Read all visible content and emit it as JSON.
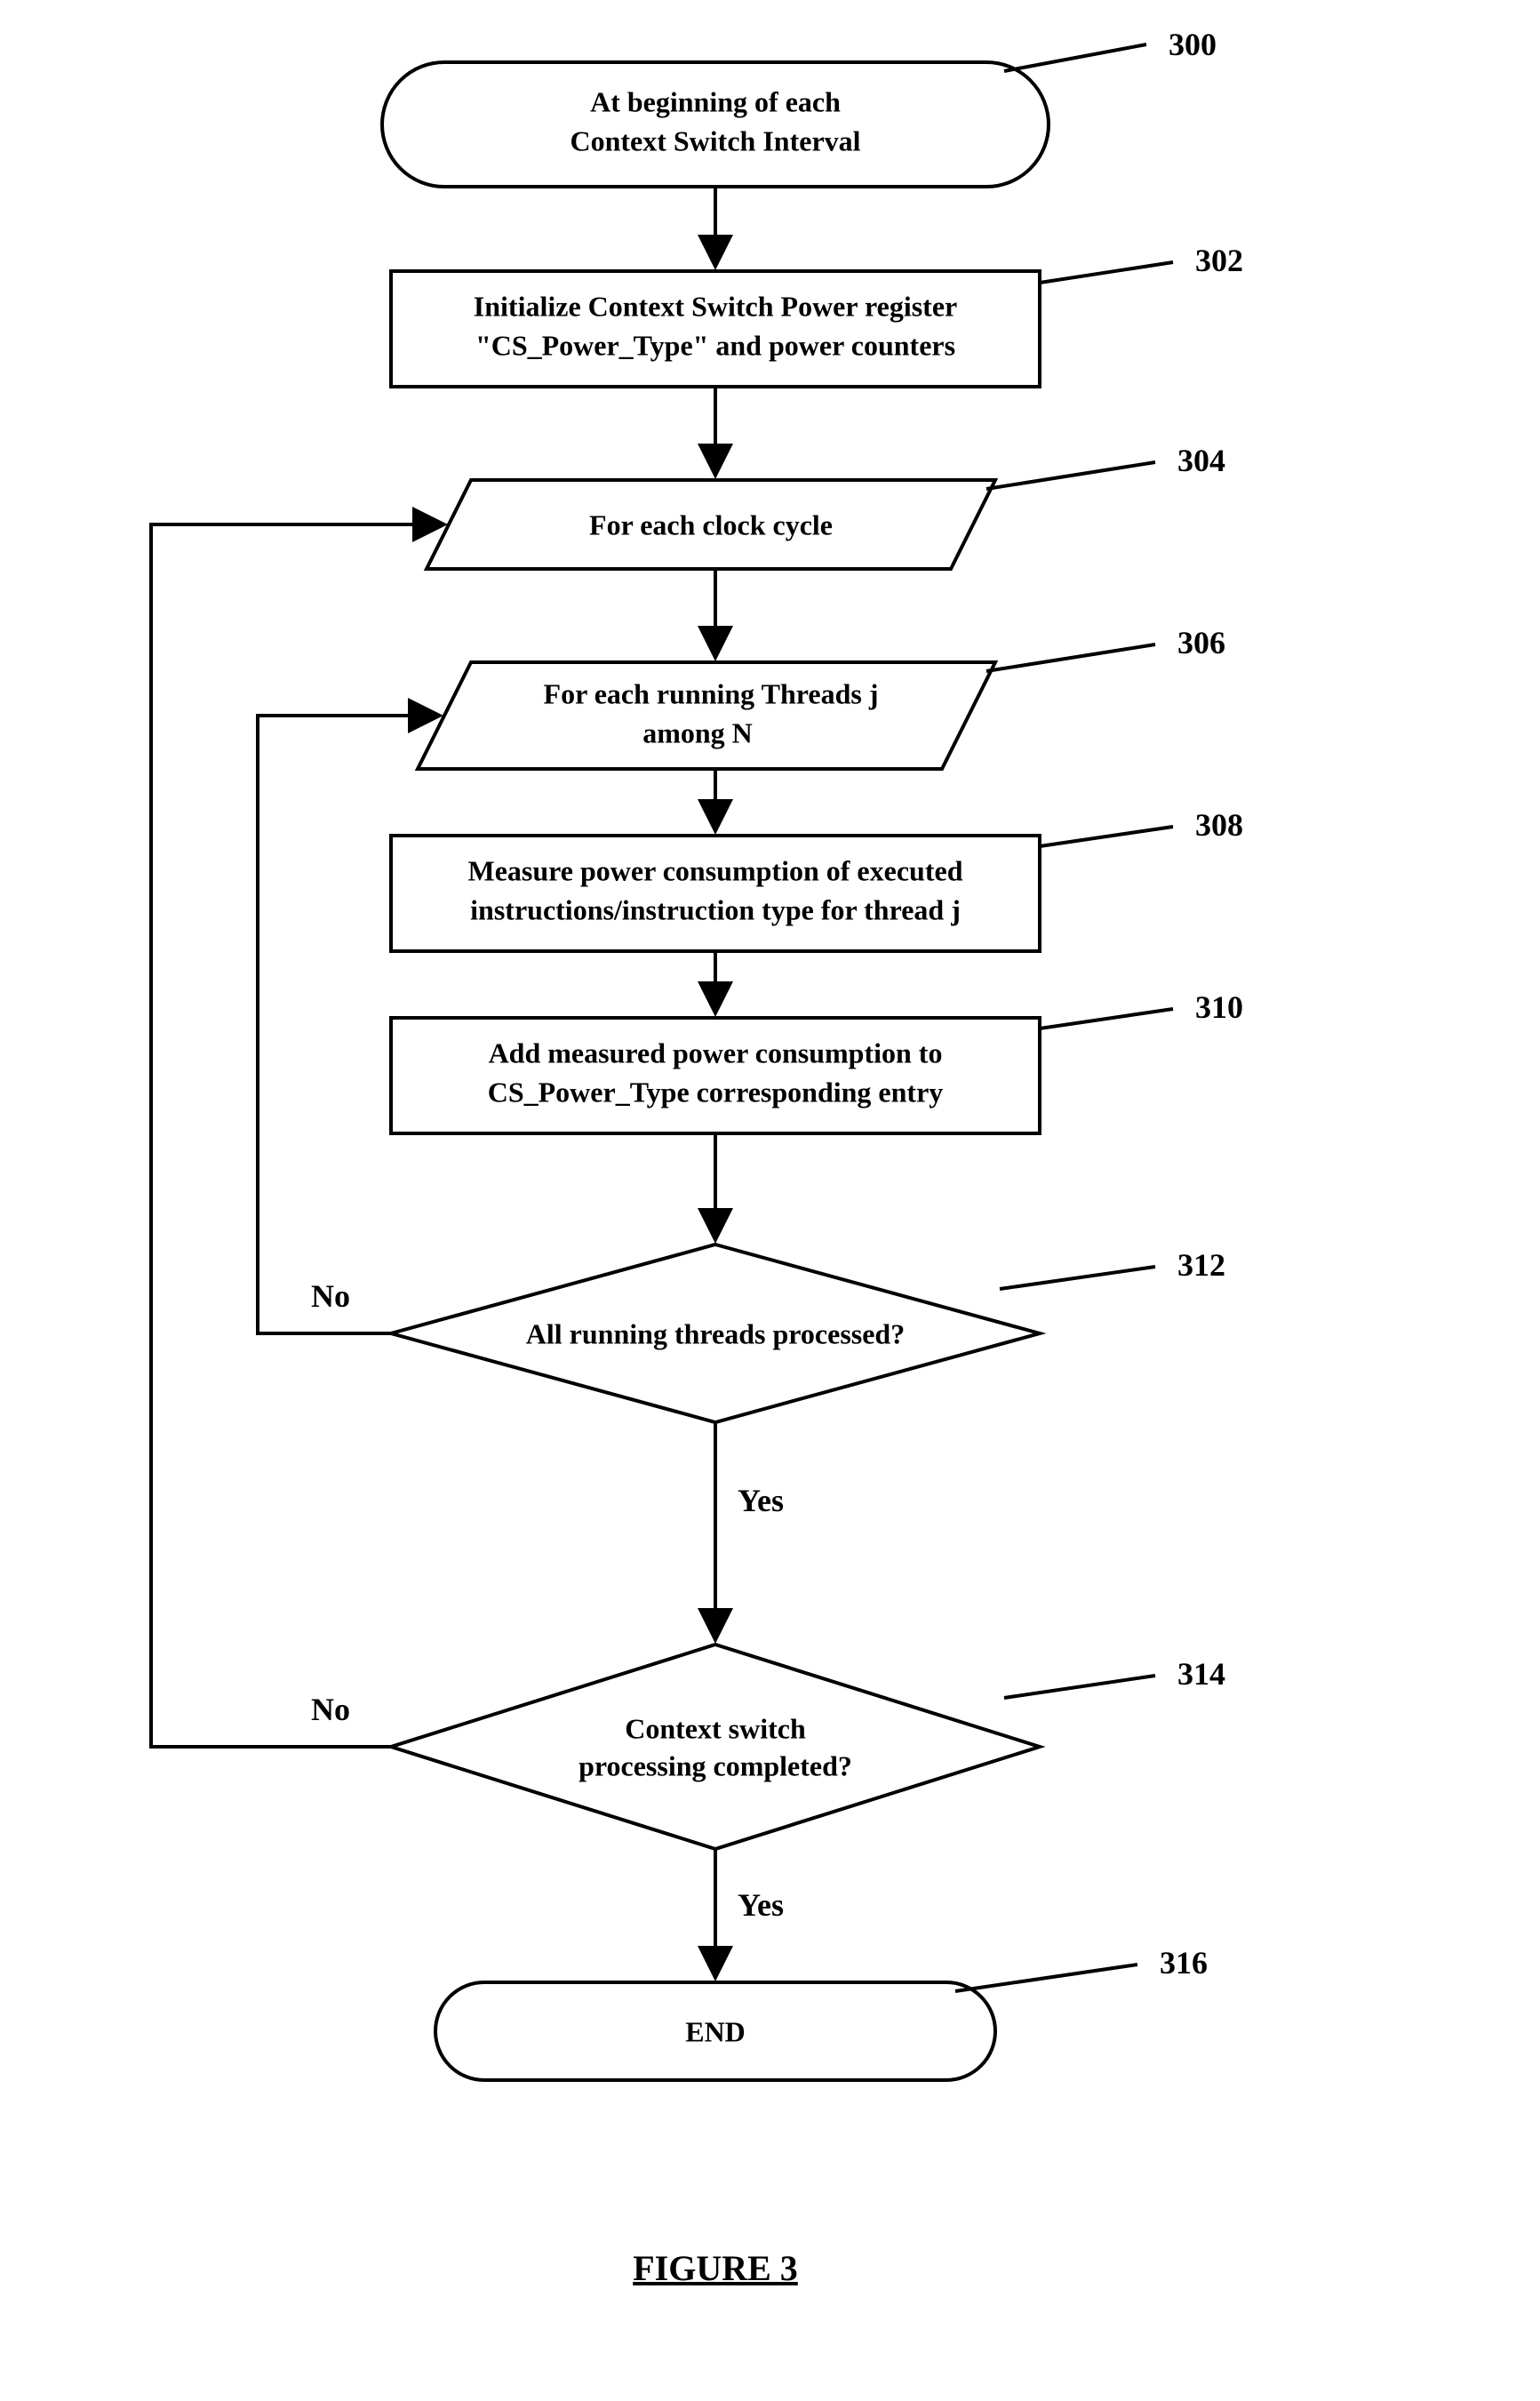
{
  "nodes": {
    "n300": {
      "label": "300",
      "line1": "At beginning of each",
      "line2": "Context Switch Interval"
    },
    "n302": {
      "label": "302",
      "line1": "Initialize Context Switch Power register",
      "line2": "\"CS_Power_Type\" and power counters"
    },
    "n304": {
      "label": "304",
      "line1": "For each clock cycle"
    },
    "n306": {
      "label": "306",
      "line1": "For each running Threads j",
      "line2": "among N"
    },
    "n308": {
      "label": "308",
      "line1": "Measure power consumption of executed",
      "line2": "instructions/instruction type for thread j"
    },
    "n310": {
      "label": "310",
      "line1": "Add measured power consumption to",
      "line2": "CS_Power_Type corresponding entry"
    },
    "n312": {
      "label": "312",
      "line1": "All running threads processed?"
    },
    "n314": {
      "label": "314",
      "line1": "Context switch",
      "line2": "processing completed?"
    },
    "n316": {
      "label": "316",
      "line1": "END"
    }
  },
  "edges": {
    "yes": "Yes",
    "no": "No"
  },
  "caption": "FIGURE  3"
}
